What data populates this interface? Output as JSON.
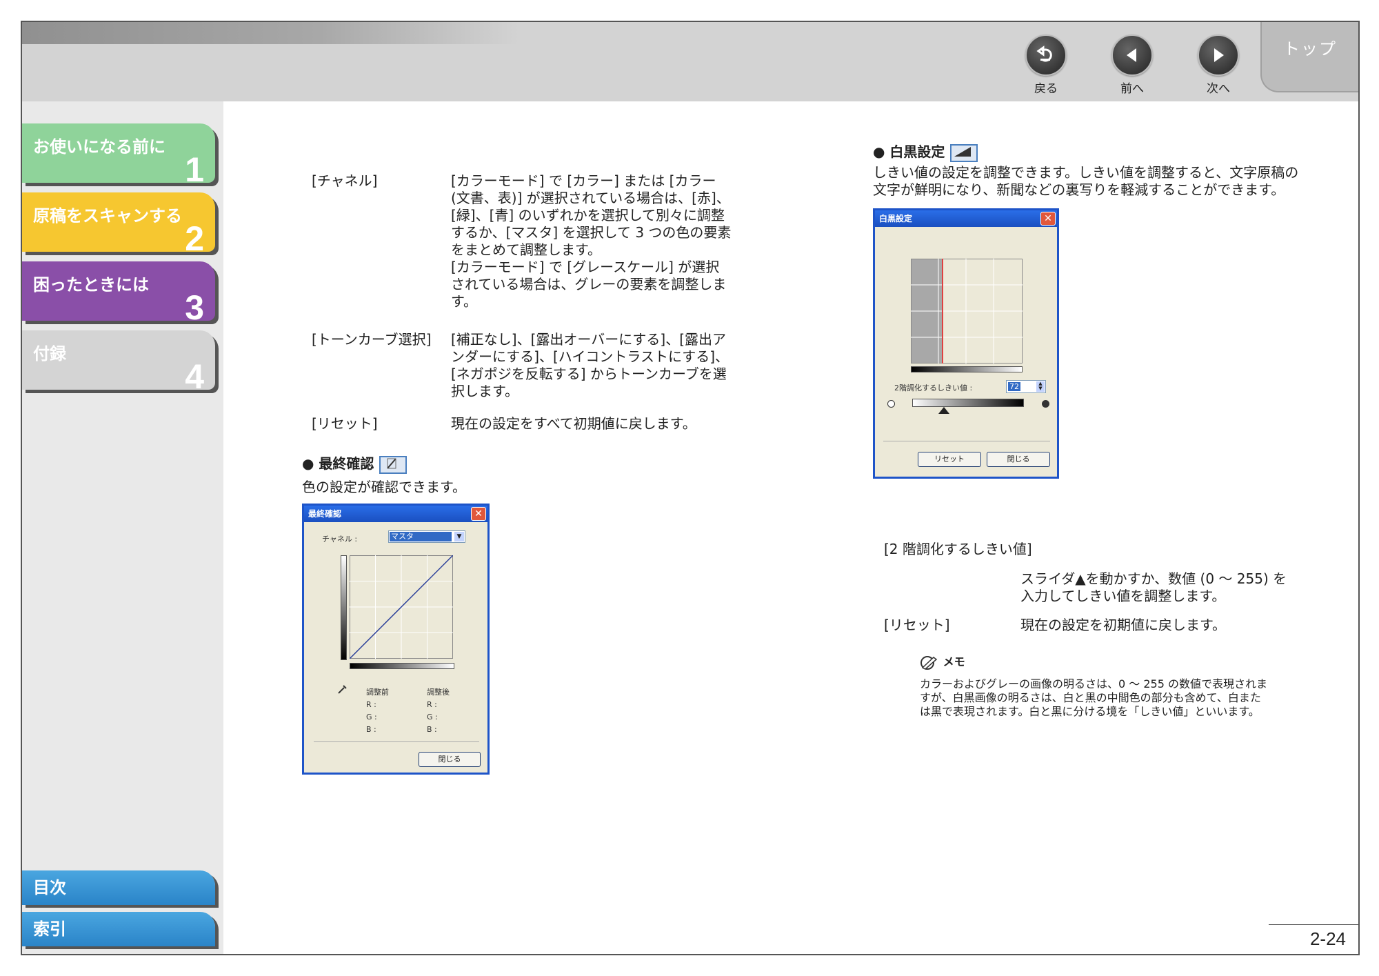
{
  "nav": {
    "back": "戻る",
    "prev": "前へ",
    "next": "次へ",
    "top": "トップ"
  },
  "chapters": [
    {
      "label": "お使いになる前に",
      "num": "1",
      "color": "#8fd39a"
    },
    {
      "label": "原稿をスキャンする",
      "num": "2",
      "color": "#f6c730"
    },
    {
      "label": "困ったときには",
      "num": "3",
      "color": "#8a4fa8"
    },
    {
      "label": "付録",
      "num": "4",
      "color": "#d4d4d4"
    }
  ],
  "bottom_tabs": {
    "toc": "目次",
    "index": "索引"
  },
  "left": {
    "channel_term": "[チャネル]",
    "channel_desc": [
      "[カラーモード] で [カラー] または [カラー",
      "(文書、表)] が選択されている場合は、[赤]、",
      "[緑]、[青] のいずれかを選択して別々に調整",
      "するか、[マスタ] を選択して 3 つの色の要素",
      "をまとめて調整します。",
      "[カラーモード] で [グレースケール] が選択",
      "されている場合は、グレーの要素を調整しま",
      "す。"
    ],
    "tone_term": "[トーンカーブ選択]",
    "tone_desc": [
      "[補正なし]、[露出オーバーにする]、[露出ア",
      "ンダーにする]、[ハイコントラストにする]、",
      "[ネガポジを反転する] からトーンカーブを選",
      "択します。"
    ],
    "reset_term": "[リセット]",
    "reset_desc": "現在の設定をすべて初期値に戻します。",
    "final_heading": "● 最終確認",
    "final_desc": "色の設定が確認できます。"
  },
  "dialog_final": {
    "title": "最終確認",
    "channel_label": "チャネル :",
    "channel_value": "マスタ",
    "before": "調整前",
    "after": "調整後",
    "r": "R :",
    "g": "G :",
    "b": "B :",
    "close": "閉じる"
  },
  "right": {
    "bw_heading": "● 白黒設定",
    "bw_desc": [
      "しきい値の設定を調整できます。しきい値を調整すると、文字原稿の",
      "文字が鮮明になり、新聞などの裏写りを軽減することができます。"
    ],
    "threshold_term": "[2 階調化するしきい値]",
    "threshold_desc": [
      "スライダ▲を動かすか、数値 (0 〜 255) を",
      "入力してしきい値を調整します。"
    ],
    "reset_term": "[リセット]",
    "reset_desc": "現在の設定を初期値に戻します。",
    "memo_title": "メモ",
    "memo_text": [
      "カラーおよびグレーの画像の明るさは、0 〜 255 の数値で表現されま",
      "すが、白黒画像の明るさは、白と黒の中間色の部分も含めて、白また",
      "は黒で表現されます。白と黒に分ける境を「しきい値」といいます。"
    ]
  },
  "dialog_bw": {
    "title": "白黒設定",
    "threshold_label": "2階調化するしきい値 :",
    "threshold_value": "72",
    "reset": "リセット",
    "close": "閉じる"
  },
  "page_number": "2-24"
}
